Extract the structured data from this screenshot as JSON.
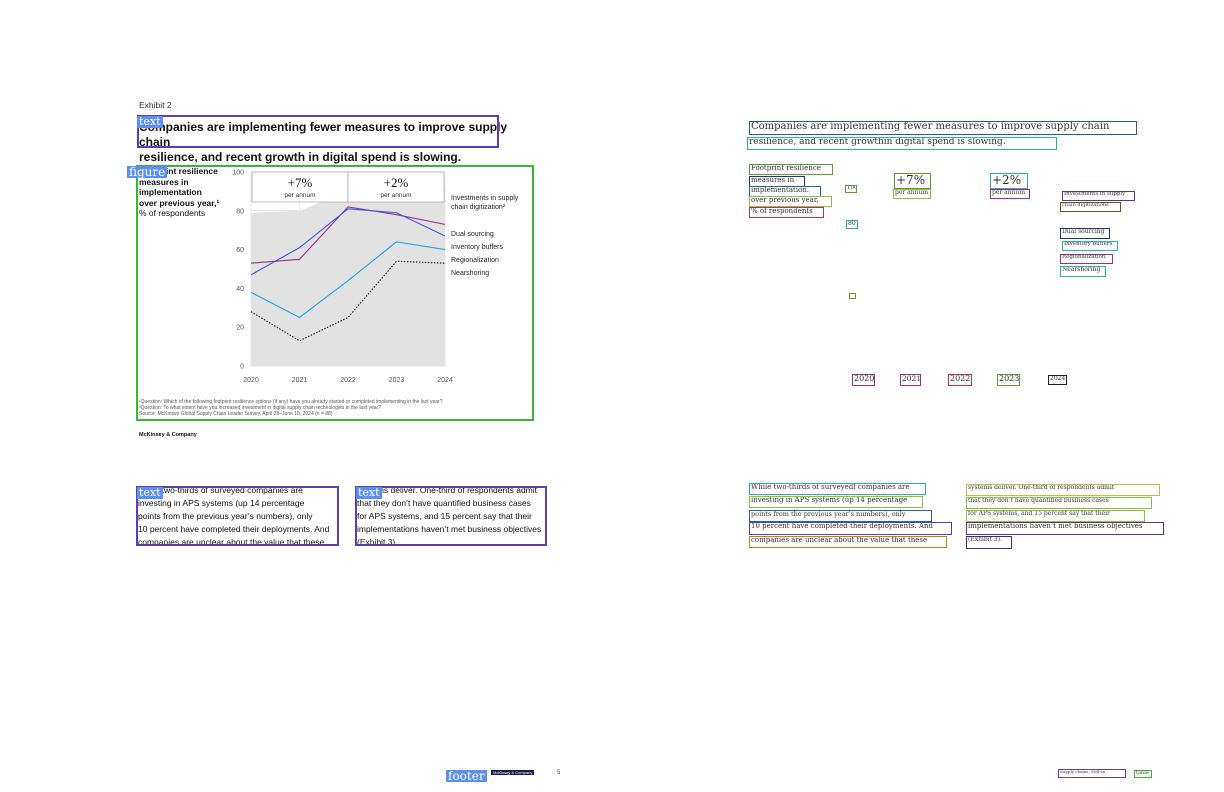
{
  "left": {
    "exhibit_label": "Exhibit 2",
    "title_line1": "Companies are implementing fewer measures to improve supply chain",
    "title_line2": "resilience, and recent growth in digital spend is slowing.",
    "tags": {
      "text": "text",
      "figure": "figure",
      "footer": "footer"
    },
    "subtitle_bold_1": "Footprint resilience",
    "subtitle_bold_2": "measures in",
    "subtitle_bold_3": "implementation",
    "subtitle_bold_4": "over previous year,¹",
    "subtitle_unit": "% of respondents",
    "callouts": [
      {
        "value": "+7%",
        "label": "per annum"
      },
      {
        "value": "+2%",
        "label": "per annum"
      }
    ],
    "footnote_1": "¹Question: Which of the following footprint resilience options (if any) have you already started or completed implementing in the last year?",
    "footnote_2": "²Question: To what extent have you increased investment in digital supply chain technologies in the last year?",
    "footnote_3": "Source: McKinsey Global Supply Chain Leader Survey, April 28–June 10, 2024 (n = 88)",
    "publisher": "McKinsey & Company",
    "col1_lines": [
      "While two-thirds of surveyed companies are",
      "investing in APS systems (up 14 percentage",
      "points from the previous year’s numbers), only",
      "10 percent have completed their deployments. And",
      "companies are unclear about the value that these"
    ],
    "col2_lines": [
      "systems deliver. One-third of respondents admit",
      "that they don’t have quantified business cases",
      "for APS systems, and 15 percent say that their",
      "implementations haven’t met business objectives",
      "(Exhibit 3)."
    ],
    "footer_text": "McKinsey & Company",
    "page_number": "5"
  },
  "colors": {
    "anno_text": "#5b3fb0",
    "anno_figure": "#3ab53a",
    "tag_bg": "#5b8ff0",
    "area": "#e2e2e2",
    "dual_sourcing": "#9b2d8c",
    "inventory_buffers": "#3b5bd9",
    "regionalization": "#1fa3e8",
    "nearshoring": "#111111"
  },
  "chart_data": {
    "type": "line",
    "title": "",
    "xlabel": "",
    "ylabel": "",
    "x": [
      "2020",
      "2021",
      "2022",
      "2023",
      "2024"
    ],
    "ylim": [
      0,
      100
    ],
    "yticks": [
      0,
      20,
      40,
      60,
      80,
      100
    ],
    "grid": true,
    "legend": "right",
    "area_series": {
      "name": "Investments in supply chain digitization²",
      "values": [
        79,
        80,
        90,
        86,
        93
      ]
    },
    "series": [
      {
        "name": "Dual sourcing",
        "values": [
          53,
          55,
          82,
          78,
          73
        ],
        "style": "solid"
      },
      {
        "name": "Inventory buffers",
        "values": [
          47,
          61,
          81,
          79,
          67
        ],
        "style": "solid"
      },
      {
        "name": "Regionalization",
        "values": [
          38,
          25,
          44,
          64,
          60
        ],
        "style": "solid"
      },
      {
        "name": "Nearshoring",
        "values": [
          28,
          13,
          25,
          54,
          53
        ],
        "style": "dotted"
      }
    ]
  },
  "right": {
    "title_line1": "Companies are implementing fewer measures to improve supply chain",
    "title_line2": "resilience, and recent growthin digital spend is slowing.",
    "subtitle_lines": [
      "Footprint resilience",
      "measures in",
      "implementation.",
      "over previous year,",
      "% of respondents"
    ],
    "y100": "100",
    "y80": "80",
    "callout1": "+7%",
    "callout1_label": "per annum",
    "callout2": "+2%",
    "callout2_label": "per annum",
    "legend_lines": [
      "Investments in supply",
      "chain digitizations",
      "Dual sourcing",
      "Inventory buffers",
      "Regionalization",
      "Nearshoring"
    ],
    "years": [
      "2020",
      "2021",
      "2022",
      "2023",
      "2024"
    ],
    "col1_lines": [
      "While two-thirds of surveyedl companies are",
      "investing in APS systems (up 14 percentage",
      "points from the previous year’s numbers), only",
      "10 percent have completed their deployments. And",
      "companies are unclear about the value that these"
    ],
    "col2_lines": [
      "systems deliver. One-third of respondents admit",
      "that they don’t have quantified business cases",
      "for APS systems, and 15 percent say that their",
      "implementations haven’t met business objectives",
      "(Exhibit 3)."
    ],
    "footer_text": "Supply chains: Still vu",
    "table_tag": "table"
  }
}
